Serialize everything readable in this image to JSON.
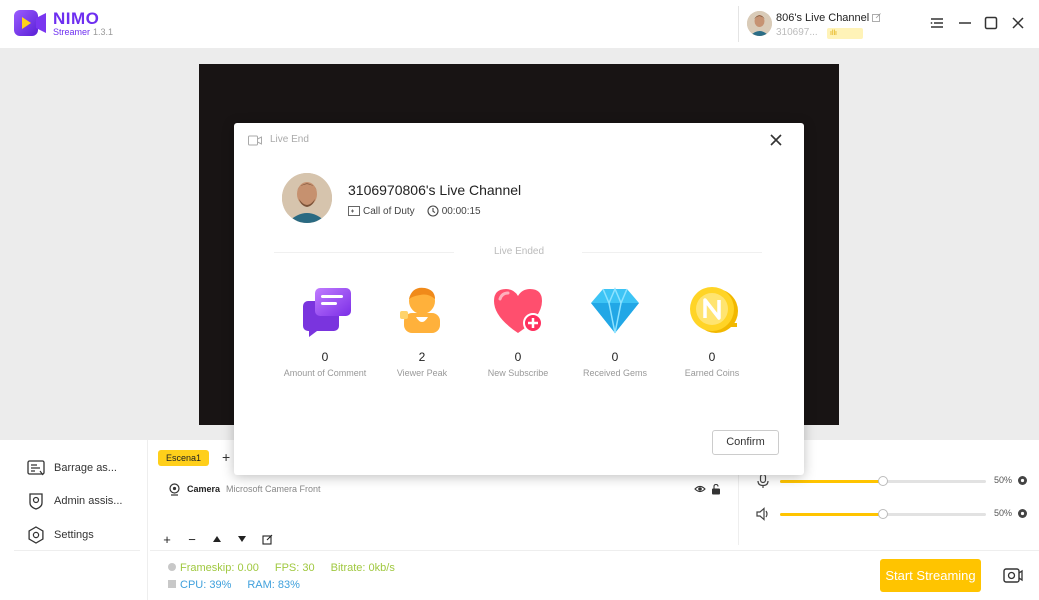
{
  "app": {
    "brand": "NIMO",
    "sub": "Streamer",
    "version": "1.3.1"
  },
  "user": {
    "name": "806's Live Channel",
    "id": "310697...",
    "level_badge": "ıllı"
  },
  "modal": {
    "title": "Live End",
    "channel_name": "3106970806's Live Channel",
    "game": "Call of Duty",
    "duration": "00:00:15",
    "ended_label": "Live Ended",
    "stats": [
      {
        "value": "0",
        "label": "Amount of Comment",
        "icon": "comment-icon"
      },
      {
        "value": "2",
        "label": "Viewer Peak",
        "icon": "viewer-icon"
      },
      {
        "value": "0",
        "label": "New Subscribe",
        "icon": "heart-plus-icon"
      },
      {
        "value": "0",
        "label": "Received Gems",
        "icon": "gem-icon"
      },
      {
        "value": "0",
        "label": "Earned Coins",
        "icon": "coin-icon"
      }
    ],
    "confirm_label": "Confirm"
  },
  "sidebar": {
    "items": [
      {
        "label": "Barrage as...",
        "icon": "barrage-icon"
      },
      {
        "label": "Admin assis...",
        "icon": "shield-icon"
      },
      {
        "label": "Settings",
        "icon": "gear-icon"
      }
    ]
  },
  "scenes": {
    "tabs": [
      "Escena1"
    ],
    "add": "+"
  },
  "sources": [
    {
      "name": "Camera",
      "desc": "Microsoft Camera Front"
    }
  ],
  "audio": {
    "mic_percent": "50%",
    "mic_level": 0.5,
    "speaker_percent": "50%",
    "speaker_level": 0.5
  },
  "stats": {
    "frameskip": "Frameskip: 0.00",
    "fps": "FPS: 30",
    "bitrate": "Bitrate: 0kb/s",
    "cpu": "CPU: 39%",
    "ram": "RAM: 83%"
  },
  "start_label": "Start Streaming",
  "colors": {
    "brand": "#6e2ff0",
    "accent": "#ffc400"
  }
}
